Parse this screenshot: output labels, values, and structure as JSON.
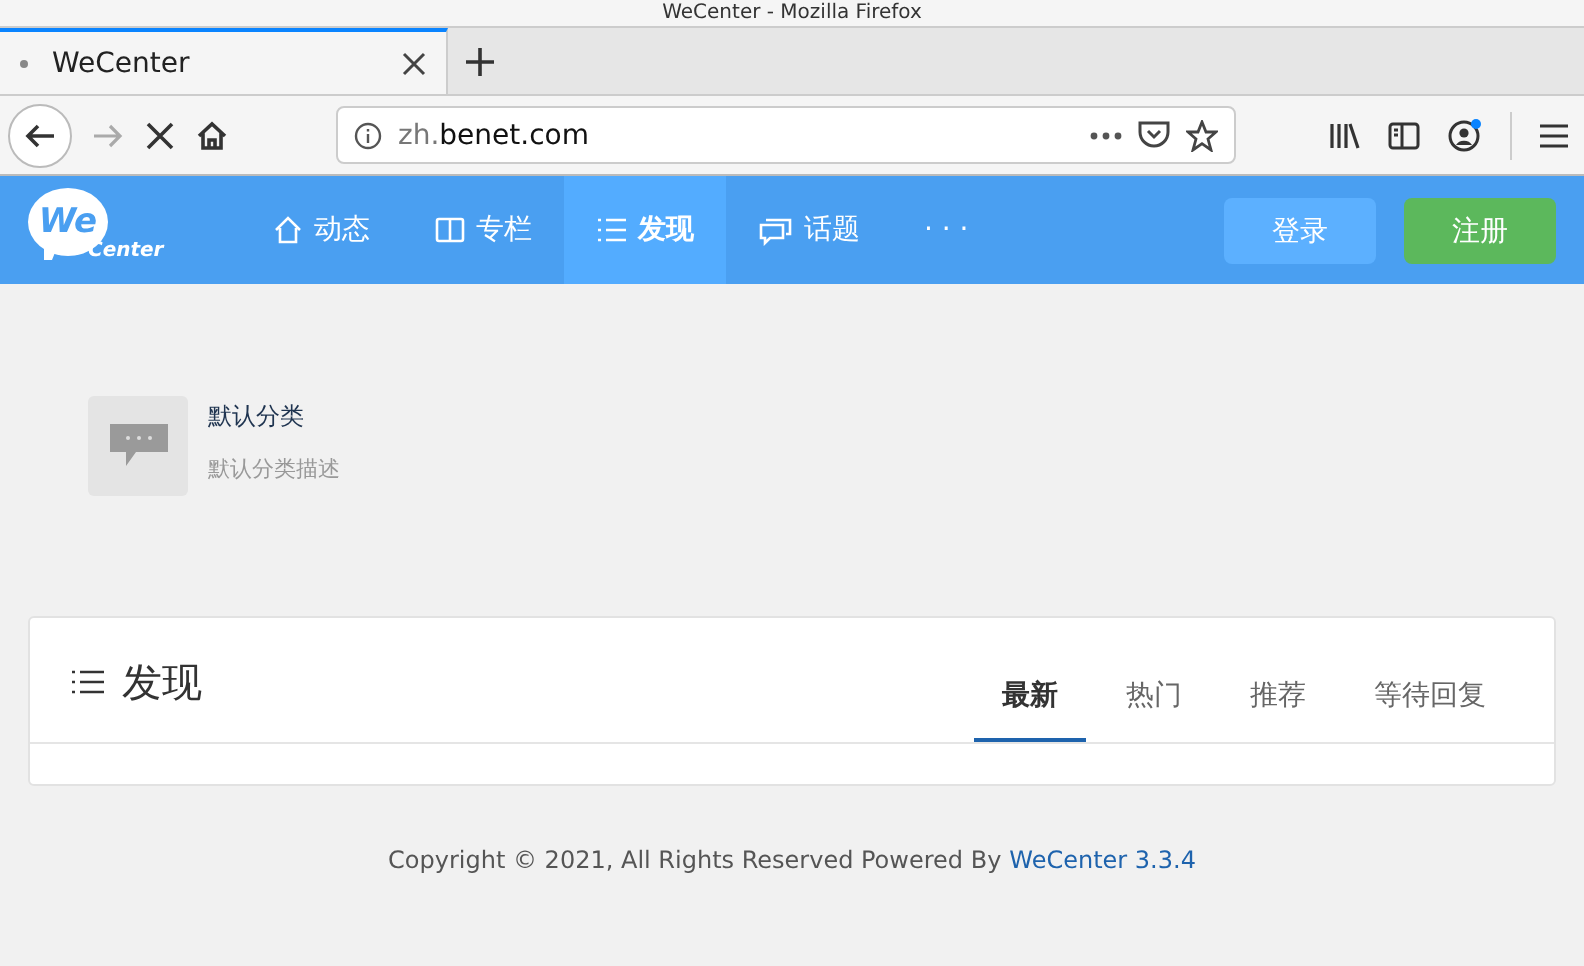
{
  "window": {
    "title": "WeCenter - Mozilla Firefox"
  },
  "browser": {
    "tab": {
      "title": "WeCenter"
    },
    "url_host_prefix": "zh.",
    "url_domain": "benet.com"
  },
  "header": {
    "logo_main": "We",
    "logo_sub": "Center",
    "nav": [
      {
        "label": "动态",
        "kind": "home",
        "selected": false
      },
      {
        "label": "专栏",
        "kind": "columns",
        "selected": false
      },
      {
        "label": "发现",
        "kind": "list",
        "selected": true
      },
      {
        "label": "话题",
        "kind": "chat",
        "selected": false
      },
      {
        "label": "· · ·",
        "kind": "more",
        "selected": false
      }
    ],
    "login": "登录",
    "register": "注册"
  },
  "category": {
    "name": "默认分类",
    "description": "默认分类描述"
  },
  "panel": {
    "title": "发现",
    "tabs": [
      {
        "label": "最新",
        "selected": true
      },
      {
        "label": "热门",
        "selected": false
      },
      {
        "label": "推荐",
        "selected": false
      },
      {
        "label": "等待回复",
        "selected": false
      }
    ]
  },
  "footer": {
    "text": "Copyright © 2021, All Rights Reserved Powered By",
    "link": "WeCenter 3.3.4"
  }
}
